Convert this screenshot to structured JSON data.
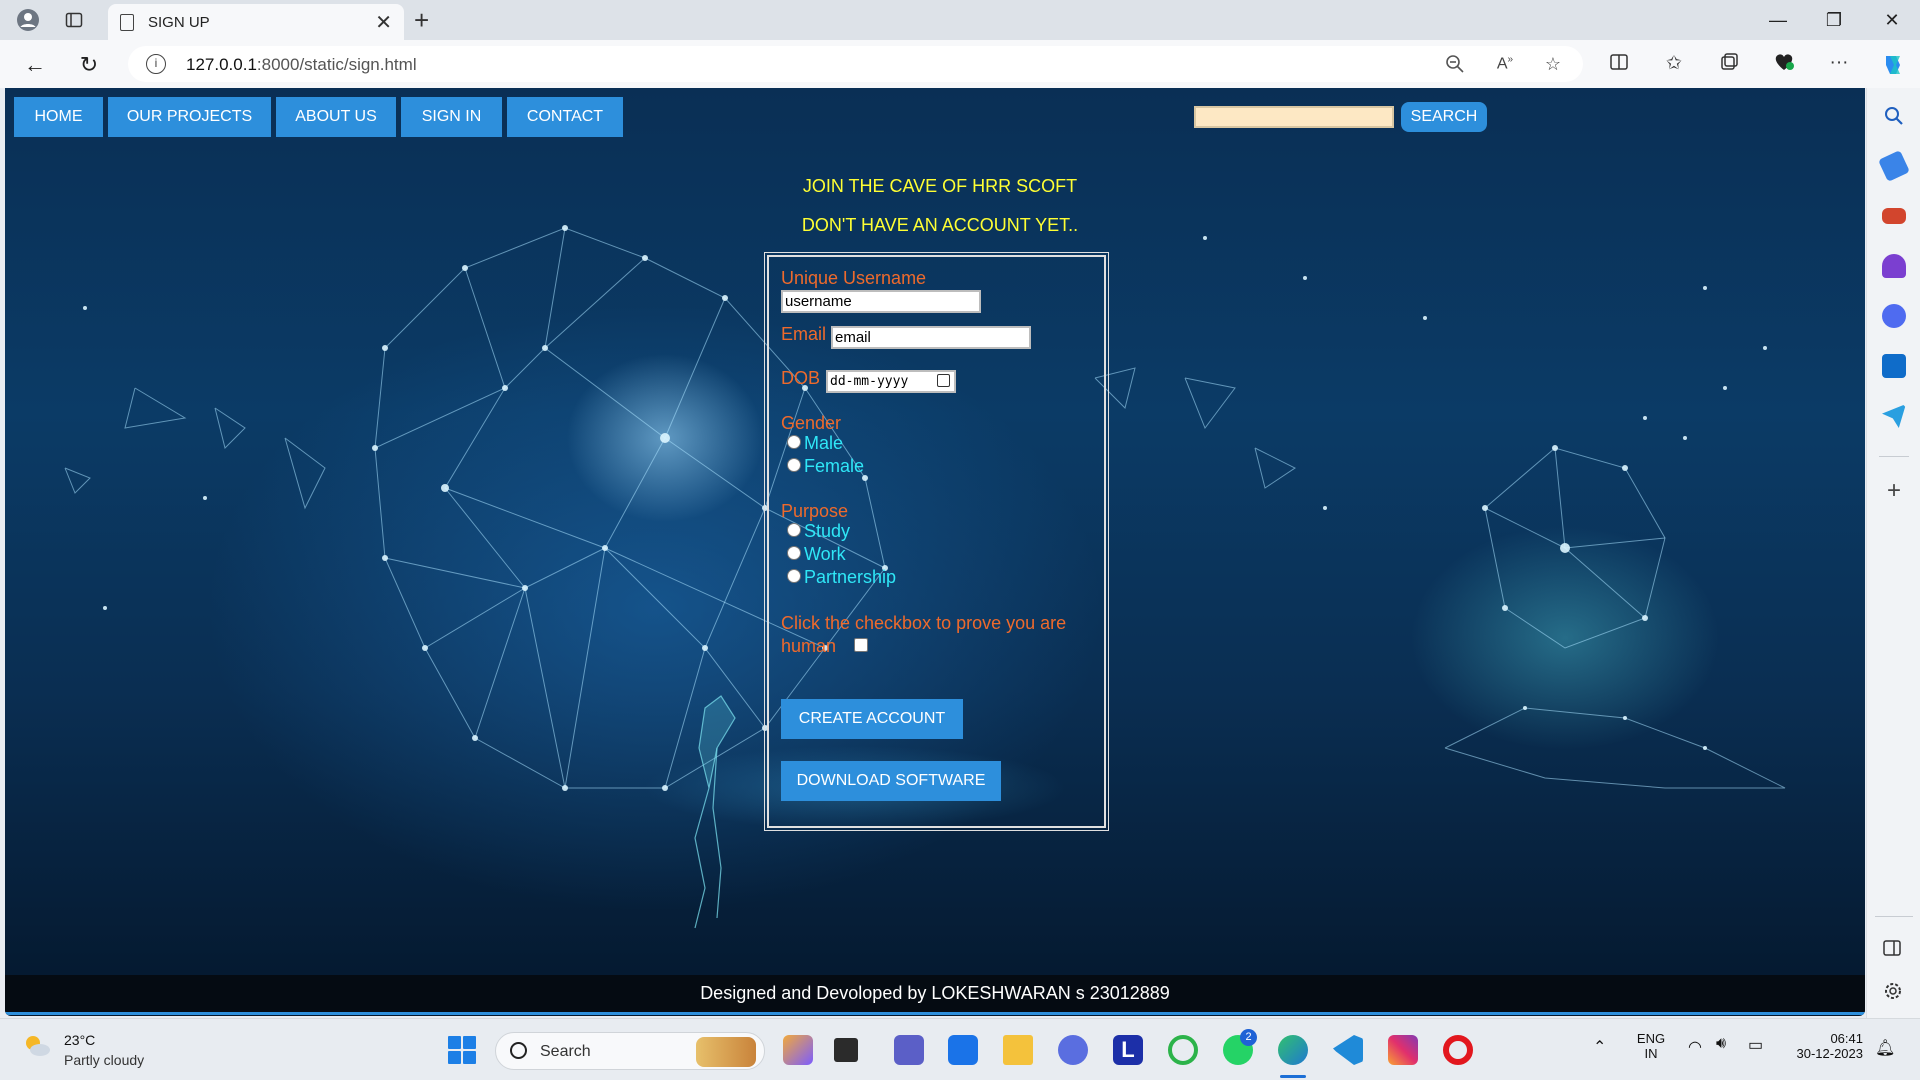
{
  "browser": {
    "tab_title": "SIGN UP",
    "url_host": "127.0.0.1",
    "url_rest": ":8000/static/sign.html"
  },
  "page": {
    "nav": [
      "HOME",
      "OUR PROJECTS",
      "ABOUT US",
      "SIGN IN",
      "CONTACT"
    ],
    "search": {
      "value": "",
      "button": "SEARCH"
    },
    "headline1": "JOIN THE CAVE OF HRR SCOFT",
    "headline2": "DON'T HAVE AN ACCOUNT YET..",
    "form": {
      "username_label": "Unique Username",
      "username_value": "username",
      "email_label": "Email",
      "email_value": "email",
      "dob_label": "DOB",
      "dob_value": "dd-mm-yyyy",
      "gender_label": "Gender",
      "gender_options": [
        "Male",
        "Female"
      ],
      "purpose_label": "Purpose",
      "purpose_options": [
        "Study",
        "Work",
        "Partnership"
      ],
      "human_label_1": "Click the checkbox to prove you are",
      "human_label_2": "human",
      "create_button": "CREATE ACCOUNT",
      "download_button": "DOWNLOAD SOFTWARE"
    },
    "footer": "Designed and Devoloped by LOKESHWARAN s 23012889"
  },
  "taskbar": {
    "temperature": "23°C",
    "condition": "Partly cloudy",
    "search_placeholder": "Search",
    "teams_badge": "2",
    "lang_1": "ENG",
    "lang_2": "IN",
    "time": "06:41",
    "date": "30-12-2023"
  },
  "colors": {
    "nav_blue": "#2d8fdc",
    "headline": "#ffff33",
    "label_orange": "#ee6a2c",
    "option_cyan": "#2fe7f7"
  }
}
